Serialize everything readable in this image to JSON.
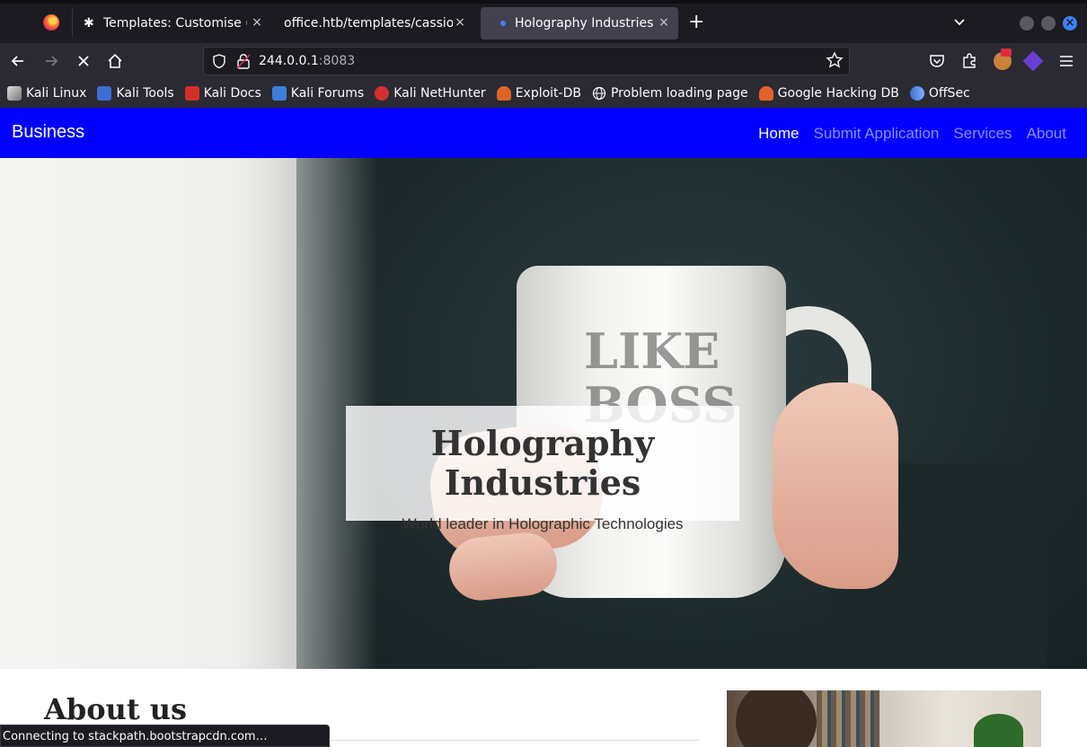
{
  "browser": {
    "tabs": [
      {
        "title": "Templates: Customise (Ca"
      },
      {
        "title": "office.htb/templates/cassiop"
      },
      {
        "title": "Holography Industries"
      }
    ],
    "close_glyph": "×",
    "new_tab_glyph": "+",
    "tab_list_glyph": "⌄",
    "url_host": "244.0.0.1",
    "url_port": ":8083",
    "status": "Connecting to stackpath.bootstrapcdn.com…",
    "window_colors": {
      "minimize": "#5a5963",
      "maximize": "#5a5963",
      "close": "#3b82f6"
    }
  },
  "bookmarks": [
    {
      "label": "Kali Linux",
      "icon": "kali-linux-icon",
      "color": "#e0e0e0"
    },
    {
      "label": "Kali Tools",
      "icon": "kali-tools-icon",
      "color": "#3b6fd6"
    },
    {
      "label": "Kali Docs",
      "icon": "kali-docs-icon",
      "color": "#d32f2f"
    },
    {
      "label": "Kali Forums",
      "icon": "kali-forums-icon",
      "color": "#3f7fd8"
    },
    {
      "label": "Kali NetHunter",
      "icon": "kali-nethunter-icon",
      "color": "#d3302f"
    },
    {
      "label": "Exploit-DB",
      "icon": "exploit-db-icon",
      "color": "#e0642a"
    },
    {
      "label": "Problem loading page",
      "icon": "globe-icon",
      "color": "#2b2a33"
    },
    {
      "label": "Google Hacking DB",
      "icon": "ghdb-icon",
      "color": "#e0642a"
    },
    {
      "label": "OffSec",
      "icon": "offsec-icon",
      "color": "#4a7fd4"
    }
  ],
  "site": {
    "brand": "Business",
    "nav": [
      {
        "label": "Home",
        "active": true
      },
      {
        "label": "Submit Application",
        "active": false
      },
      {
        "label": "Services",
        "active": false
      },
      {
        "label": "About",
        "active": false
      }
    ],
    "nav_color": "#0000ff",
    "hero_title": "Holography Industries",
    "hero_subtitle": "World leader in Holographic Technologies",
    "mug_text": "LIKE BOSS",
    "about_heading": "About us"
  }
}
